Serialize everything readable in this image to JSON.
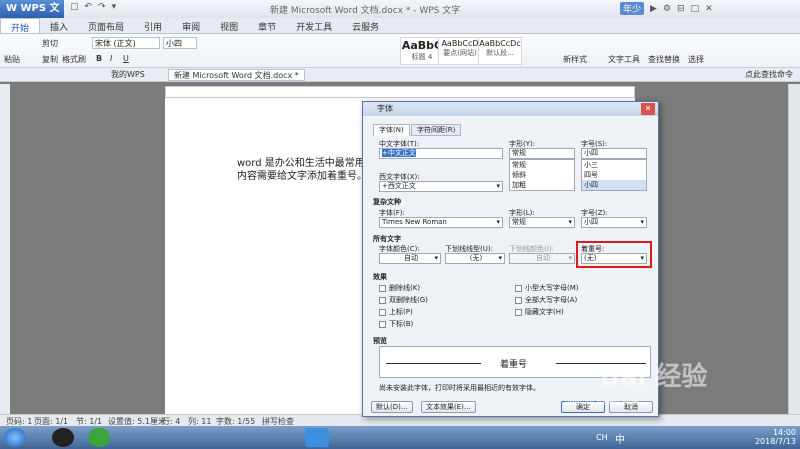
{
  "app": {
    "logo": "W WPS 文字",
    "title": "新建 Microsoft Word 文档.docx * - WPS 文字"
  },
  "titlebar_right": {
    "user": "年少",
    "icons": [
      "▶",
      "⚙",
      "⊟",
      "□",
      "✕"
    ]
  },
  "quick_access": [
    "▢",
    "↶",
    "↷",
    "▾"
  ],
  "ribbon_tabs": [
    "开始",
    "插入",
    "页面布局",
    "引用",
    "审阅",
    "视图",
    "章节",
    "开发工具",
    "云服务"
  ],
  "ribbon": {
    "paste": "粘贴",
    "cut": "剪切",
    "copy": "复制",
    "format_painter": "格式刷",
    "font_name": "宋体 (正文)",
    "font_size": "小四",
    "bold": "B",
    "italic": "I",
    "underline": "U",
    "styles": [
      {
        "preview": "AaBbC",
        "name": "标题 4"
      },
      {
        "preview": "AaBbCcD",
        "name": "要点(网站)"
      },
      {
        "preview": "AaBbCcDc",
        "name": "默认段..."
      }
    ],
    "new_style": "新样式",
    "text_tools": "文字工具",
    "find_replace": "查找替换",
    "select": "选择"
  },
  "doc_tabs": [
    {
      "label": "我的WPS"
    },
    {
      "label": "新建 Microsoft Word 文档.docx *"
    }
  ],
  "doc_tabs_right": "点此查找命令",
  "document": {
    "line1": "word 是办公和生活中最常用的",
    "line2": "内容需要给文字添加着重号。"
  },
  "status": {
    "page": "页码: 1",
    "pages": "页面: 1/1",
    "section": "节: 1/1",
    "setting": "设置值: 5.1厘米",
    "row": "行: 4",
    "col": "列: 11",
    "words": "字数: 1/55",
    "spell": "拼写检查"
  },
  "taskbar": {
    "time": "14:00",
    "date": "2018/7/13",
    "lang": "CH",
    "ime": "中"
  },
  "dialog": {
    "title": "字体",
    "tabs": [
      "字体(N)",
      "字符间距(R)"
    ],
    "chinese_font_label": "中文字体(T):",
    "chinese_font": "+中文正文",
    "style_label": "字形(Y):",
    "style_value": "常规",
    "style_list": [
      "常规",
      "倾斜",
      "加粗"
    ],
    "size_label": "字号(S):",
    "size_value": "小四",
    "size_list": [
      "小三",
      "四号",
      "小四"
    ],
    "western_font_label": "西文字体(X):",
    "western_font": "+西文正文",
    "complex_section": "复杂文种",
    "complex_font_label": "字体(F):",
    "complex_font": "Times New Roman",
    "complex_style_label": "字形(L):",
    "complex_style": "常规",
    "complex_size_label": "字号(Z):",
    "complex_size": "小四",
    "all_text_section": "所有文字",
    "font_color_label": "字体颜色(C):",
    "font_color": "自动",
    "underline_type_label": "下划线线型(U):",
    "underline_type": "(无)",
    "underline_color_label": "下划线颜色(I):",
    "underline_color": "自动",
    "emphasis_label": "着重号:",
    "emphasis": "(无)",
    "effects_section": "效果",
    "effects_left": [
      "删除线(K)",
      "双删除线(G)",
      "上标(P)",
      "下标(B)"
    ],
    "effects_right": [
      "小型大写字母(M)",
      "全部大写字母(A)",
      "隐藏文字(H)"
    ],
    "preview_section": "预览",
    "preview_text": "着重号",
    "note": "尚未安装此字体，打印时将采用最相近的有效字体。",
    "btn_default": "默认(D)...",
    "btn_effects": "文本效果(E)...",
    "btn_ok": "确定",
    "btn_cancel": "取消"
  },
  "watermark": {
    "text": "Bai 经验",
    "url": "jingyan.baidu.com"
  }
}
